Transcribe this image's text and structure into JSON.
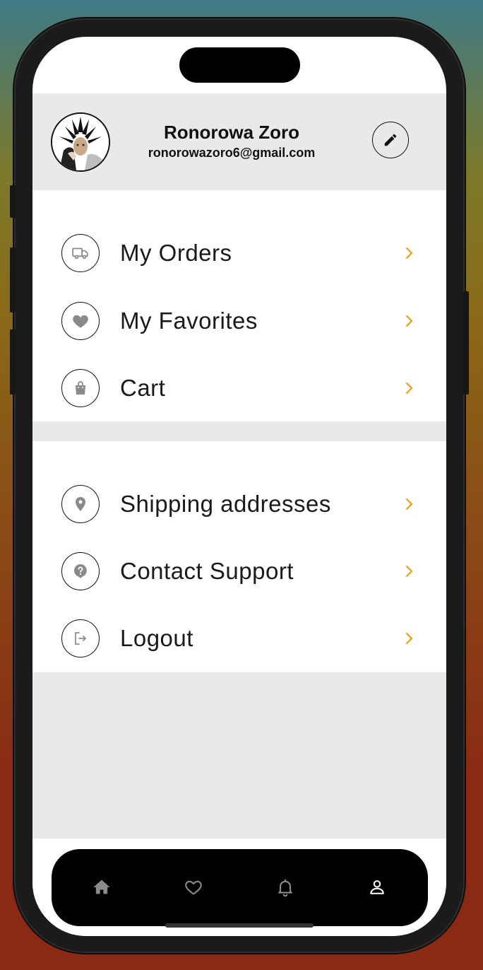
{
  "profile": {
    "name": "Ronorowa Zoro",
    "email": "ronorowazoro6@gmail.com"
  },
  "menu_primary": [
    {
      "label": "My Orders",
      "icon": "truck-icon"
    },
    {
      "label": "My Favorites",
      "icon": "heart-icon"
    },
    {
      "label": "Cart",
      "icon": "shopping-bag-icon"
    }
  ],
  "menu_secondary": [
    {
      "label": "Shipping addresses",
      "icon": "location-pin-icon"
    },
    {
      "label": "Contact Support",
      "icon": "help-icon"
    },
    {
      "label": "Logout",
      "icon": "logout-icon"
    }
  ],
  "tabs": [
    {
      "name": "home",
      "icon": "home-icon",
      "active": false
    },
    {
      "name": "favorites",
      "icon": "heart-outline-icon",
      "active": false
    },
    {
      "name": "notifications",
      "icon": "bell-icon",
      "active": false
    },
    {
      "name": "profile",
      "icon": "person-icon",
      "active": true
    }
  ],
  "colors": {
    "accent": "#f39c12",
    "header_bg": "#e9e9e9",
    "tabbar_bg": "#000000",
    "icon_gray": "#8a8a8a"
  }
}
